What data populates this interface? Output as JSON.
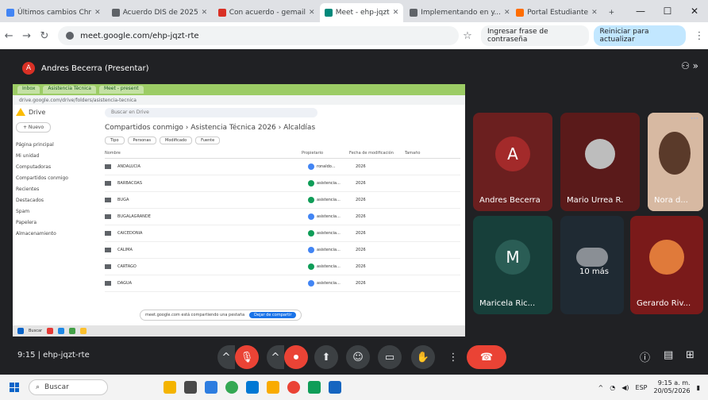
{
  "browser": {
    "tabs": [
      {
        "title": "Últimos cambios Chr",
        "color": "#4285f4"
      },
      {
        "title": "Acuerdo DIS de 2025",
        "color": "#5f6368"
      },
      {
        "title": "Con acuerdo - gemail",
        "color": "#d93025"
      },
      {
        "title": "Meet - ehp-jqzt",
        "color": "#00897b",
        "active": true
      },
      {
        "title": "Implementando en y...",
        "color": "#5f6368"
      },
      {
        "title": "Portal Estudiante",
        "color": "#ff6d00"
      }
    ],
    "new_tab": "+",
    "window": {
      "minimize": "—",
      "maximize": "☐",
      "close": "✕"
    },
    "url": "meet.google.com/ehp-jqzt-rte",
    "incognito_text": "Ingresar frase de contraseña",
    "update_text": "Reiniciar para actualizar"
  },
  "meet": {
    "presenter_initial": "A",
    "presenter_label": "Andres Becerra (Presentar)",
    "participants": [
      {
        "name": "Andres Becerra",
        "initial": "A",
        "bg": "#6b1f1f",
        "avatar": "#a32a2a"
      },
      {
        "name": "Mario Urrea R.",
        "initial": "",
        "bg": "#5a1a1a",
        "avatar": "#bdbdbd"
      },
      {
        "name": "Nora d...",
        "initial": "",
        "bg": "#d7b9a2",
        "avatar": ""
      },
      {
        "name": "Maricela Ric...",
        "initial": "M",
        "bg": "#173f3a",
        "avatar": "#2a5d55"
      },
      {
        "name": "10 más",
        "initial": "",
        "bg": "#1f2a33",
        "avatar": ""
      },
      {
        "name": "Gerardo Riv...",
        "initial": "",
        "bg": "#7a1a1a",
        "avatar": "#e07a3a"
      }
    ],
    "meeting_code": "9:15  |  ehp-jqzt-rte"
  },
  "shared_screen": {
    "tabs": [
      "Inbox",
      "Asistencia Técnica",
      "Meet - present"
    ],
    "omnibox": "drive.google.com/drive/folders/asistencia-tecnica",
    "app_name": "Drive",
    "new_label": "+ Nuevo",
    "sidebar": [
      "Página principal",
      "Mi unidad",
      "Computadoras",
      "Compartidos conmigo",
      "Recientes",
      "Destacados",
      "Spam",
      "Papelera",
      "Almacenamiento"
    ],
    "search": "Buscar en Drive",
    "breadcrumb": "Compartidos conmigo  ›  Asistencia Técnica 2026  ›  Alcaldías",
    "filters": [
      "Tipo",
      "Personas",
      "Modificado",
      "Fuente"
    ],
    "columns": [
      "Nombre",
      "Propietario",
      "Fecha de modificación",
      "Tamaño"
    ],
    "rows": [
      {
        "name": "ANDALUCIA",
        "owner": "ronaldo...",
        "date": "2026",
        "owner_color": "#4285f4"
      },
      {
        "name": "BARBACOAS",
        "owner": "asistencia...",
        "date": "2026",
        "owner_color": "#0f9d58"
      },
      {
        "name": "BUGA",
        "owner": "asistencia...",
        "date": "2026",
        "owner_color": "#0f9d58"
      },
      {
        "name": "BUGALAGRANDE",
        "owner": "asistencia...",
        "date": "2026",
        "owner_color": "#4285f4"
      },
      {
        "name": "CAICEDONIA",
        "owner": "asistencia...",
        "date": "2026",
        "owner_color": "#0f9d58"
      },
      {
        "name": "CALIMA",
        "owner": "asistencia...",
        "date": "2026",
        "owner_color": "#4285f4"
      },
      {
        "name": "CARTAGO",
        "owner": "asistencia...",
        "date": "2026",
        "owner_color": "#0f9d58"
      },
      {
        "name": "DAGUA",
        "owner": "asistencia...",
        "date": "2026",
        "owner_color": "#4285f4"
      }
    ],
    "share_banner": "meet.google.com está compartiendo una pestaña",
    "stop_label": "Dejar de compartir",
    "taskbar_search": "Buscar"
  },
  "controls": {
    "caret": "^",
    "mic": "🎙",
    "cam": "⏺",
    "present": "⬆",
    "emoji": "☺",
    "captions": "▭",
    "hand": "✋",
    "more": "⋮",
    "end": "☎",
    "info": "ⓘ",
    "chat": "▤",
    "activities": "⊞"
  },
  "taskbar": {
    "search": "Buscar",
    "time": "9:15 a. m.",
    "date": "20/05/2026",
    "lang": "ESP"
  }
}
